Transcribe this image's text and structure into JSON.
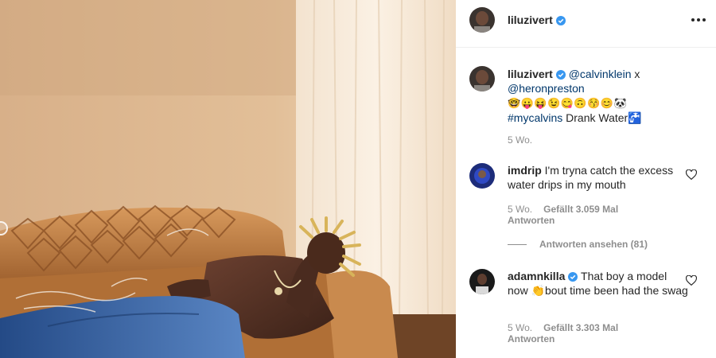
{
  "post": {
    "author": "liluzivert",
    "more_icon": "more-horizontal-icon",
    "verified_icon": "verified-badge-icon"
  },
  "caption": {
    "username": "liluzivert",
    "mention1": "@calvinklein",
    "separator": " x",
    "mention2": "@heronpreston",
    "emojis": "🤓😛😝😉😋🙃😚😊🐼",
    "hashtag": "#mycalvins",
    "text": " Drank Water🚰",
    "time": "5 Wo."
  },
  "comments": [
    {
      "username": "imdrip",
      "text": "I'm tryna catch the excess water drips in my mouth",
      "time": "5 Wo.",
      "likes": "Gefällt 3.059 Mal",
      "reply": "Antworten",
      "verified": false
    },
    {
      "username": "adamnkilla",
      "text": "That boy a model now 👏bout time been had the swag",
      "time": "5 Wo.",
      "likes": "Gefällt 3.303 Mal",
      "reply": "Antworten",
      "verified": true
    }
  ],
  "view_replies": "Antworten ansehen (81)",
  "colors": {
    "link": "#00376b",
    "verified": "#3897f0",
    "muted": "#8e8e8e",
    "wall": "#d9b48e",
    "sofa": "#c98a4e",
    "jeans": "#3a5f9a"
  }
}
